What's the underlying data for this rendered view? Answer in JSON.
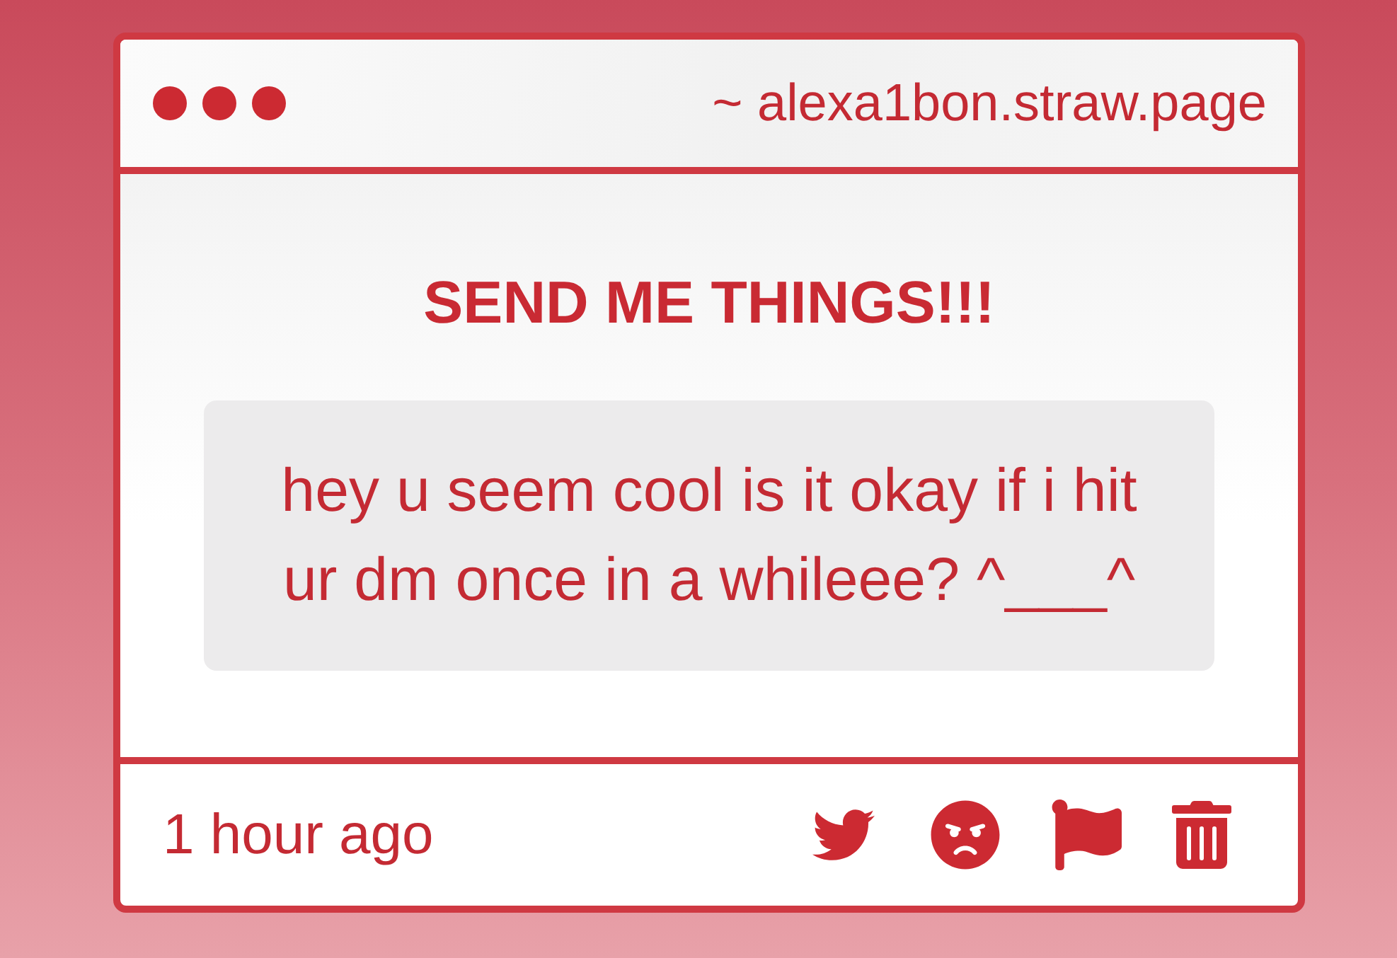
{
  "window": {
    "address": "~ alexa1bon.straw.page"
  },
  "prompt": {
    "title": "SEND ME THINGS!!!"
  },
  "message": {
    "text": "hey u seem cool is it okay if i hit ur dm once in a whileee? ^___^"
  },
  "footer": {
    "time": "1 hour ago"
  }
}
